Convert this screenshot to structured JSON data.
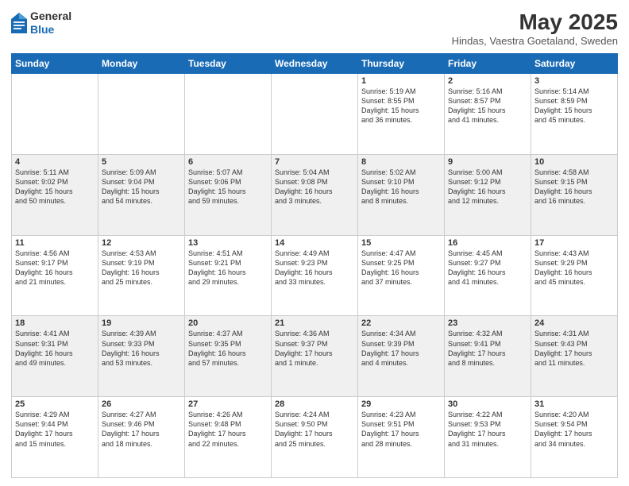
{
  "header": {
    "logo_general": "General",
    "logo_blue": "Blue",
    "month": "May 2025",
    "location": "Hindas, Vaestra Goetaland, Sweden"
  },
  "weekdays": [
    "Sunday",
    "Monday",
    "Tuesday",
    "Wednesday",
    "Thursday",
    "Friday",
    "Saturday"
  ],
  "weeks": [
    [
      {
        "date": "",
        "info": ""
      },
      {
        "date": "",
        "info": ""
      },
      {
        "date": "",
        "info": ""
      },
      {
        "date": "",
        "info": ""
      },
      {
        "date": "1",
        "info": "Sunrise: 5:19 AM\nSunset: 8:55 PM\nDaylight: 15 hours\nand 36 minutes."
      },
      {
        "date": "2",
        "info": "Sunrise: 5:16 AM\nSunset: 8:57 PM\nDaylight: 15 hours\nand 41 minutes."
      },
      {
        "date": "3",
        "info": "Sunrise: 5:14 AM\nSunset: 8:59 PM\nDaylight: 15 hours\nand 45 minutes."
      }
    ],
    [
      {
        "date": "4",
        "info": "Sunrise: 5:11 AM\nSunset: 9:02 PM\nDaylight: 15 hours\nand 50 minutes."
      },
      {
        "date": "5",
        "info": "Sunrise: 5:09 AM\nSunset: 9:04 PM\nDaylight: 15 hours\nand 54 minutes."
      },
      {
        "date": "6",
        "info": "Sunrise: 5:07 AM\nSunset: 9:06 PM\nDaylight: 15 hours\nand 59 minutes."
      },
      {
        "date": "7",
        "info": "Sunrise: 5:04 AM\nSunset: 9:08 PM\nDaylight: 16 hours\nand 3 minutes."
      },
      {
        "date": "8",
        "info": "Sunrise: 5:02 AM\nSunset: 9:10 PM\nDaylight: 16 hours\nand 8 minutes."
      },
      {
        "date": "9",
        "info": "Sunrise: 5:00 AM\nSunset: 9:12 PM\nDaylight: 16 hours\nand 12 minutes."
      },
      {
        "date": "10",
        "info": "Sunrise: 4:58 AM\nSunset: 9:15 PM\nDaylight: 16 hours\nand 16 minutes."
      }
    ],
    [
      {
        "date": "11",
        "info": "Sunrise: 4:56 AM\nSunset: 9:17 PM\nDaylight: 16 hours\nand 21 minutes."
      },
      {
        "date": "12",
        "info": "Sunrise: 4:53 AM\nSunset: 9:19 PM\nDaylight: 16 hours\nand 25 minutes."
      },
      {
        "date": "13",
        "info": "Sunrise: 4:51 AM\nSunset: 9:21 PM\nDaylight: 16 hours\nand 29 minutes."
      },
      {
        "date": "14",
        "info": "Sunrise: 4:49 AM\nSunset: 9:23 PM\nDaylight: 16 hours\nand 33 minutes."
      },
      {
        "date": "15",
        "info": "Sunrise: 4:47 AM\nSunset: 9:25 PM\nDaylight: 16 hours\nand 37 minutes."
      },
      {
        "date": "16",
        "info": "Sunrise: 4:45 AM\nSunset: 9:27 PM\nDaylight: 16 hours\nand 41 minutes."
      },
      {
        "date": "17",
        "info": "Sunrise: 4:43 AM\nSunset: 9:29 PM\nDaylight: 16 hours\nand 45 minutes."
      }
    ],
    [
      {
        "date": "18",
        "info": "Sunrise: 4:41 AM\nSunset: 9:31 PM\nDaylight: 16 hours\nand 49 minutes."
      },
      {
        "date": "19",
        "info": "Sunrise: 4:39 AM\nSunset: 9:33 PM\nDaylight: 16 hours\nand 53 minutes."
      },
      {
        "date": "20",
        "info": "Sunrise: 4:37 AM\nSunset: 9:35 PM\nDaylight: 16 hours\nand 57 minutes."
      },
      {
        "date": "21",
        "info": "Sunrise: 4:36 AM\nSunset: 9:37 PM\nDaylight: 17 hours\nand 1 minute."
      },
      {
        "date": "22",
        "info": "Sunrise: 4:34 AM\nSunset: 9:39 PM\nDaylight: 17 hours\nand 4 minutes."
      },
      {
        "date": "23",
        "info": "Sunrise: 4:32 AM\nSunset: 9:41 PM\nDaylight: 17 hours\nand 8 minutes."
      },
      {
        "date": "24",
        "info": "Sunrise: 4:31 AM\nSunset: 9:43 PM\nDaylight: 17 hours\nand 11 minutes."
      }
    ],
    [
      {
        "date": "25",
        "info": "Sunrise: 4:29 AM\nSunset: 9:44 PM\nDaylight: 17 hours\nand 15 minutes."
      },
      {
        "date": "26",
        "info": "Sunrise: 4:27 AM\nSunset: 9:46 PM\nDaylight: 17 hours\nand 18 minutes."
      },
      {
        "date": "27",
        "info": "Sunrise: 4:26 AM\nSunset: 9:48 PM\nDaylight: 17 hours\nand 22 minutes."
      },
      {
        "date": "28",
        "info": "Sunrise: 4:24 AM\nSunset: 9:50 PM\nDaylight: 17 hours\nand 25 minutes."
      },
      {
        "date": "29",
        "info": "Sunrise: 4:23 AM\nSunset: 9:51 PM\nDaylight: 17 hours\nand 28 minutes."
      },
      {
        "date": "30",
        "info": "Sunrise: 4:22 AM\nSunset: 9:53 PM\nDaylight: 17 hours\nand 31 minutes."
      },
      {
        "date": "31",
        "info": "Sunrise: 4:20 AM\nSunset: 9:54 PM\nDaylight: 17 hours\nand 34 minutes."
      }
    ]
  ]
}
